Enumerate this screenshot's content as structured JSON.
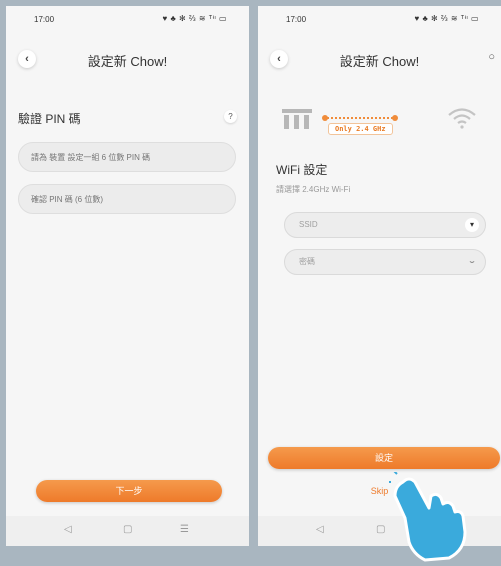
{
  "left": {
    "status": {
      "time": "17:00",
      "icons": "♥ ♣ ✻ ⅔ ≋ ᵀᶤᶥ ▭"
    },
    "header": {
      "title": "設定新 Chow!",
      "back_icon": "chevron-left"
    },
    "section_label": "驗證 PIN 碼",
    "help_label": "?",
    "pin_placeholder": "請為 裝置 設定一組 6 位數 PIN 碼",
    "confirm_placeholder": "確認 PIN 碼 (6 位數)",
    "next_label": "下一步",
    "nav": {
      "back": "◁",
      "home": "▢",
      "menu": "☰"
    }
  },
  "right": {
    "status": {
      "time": "17:00",
      "icons": "♥ ♣ ✻ ⅔ ≋ ᵀᶤᶥ ▭"
    },
    "header": {
      "title": "設定新 Chow!",
      "refresh": "○"
    },
    "only_badge": "Only 2.4 GHz",
    "wifi_title": "WiFi 設定",
    "wifi_sub": "請選擇 2.4GHz Wi-Fi",
    "ssid_label": "SSID",
    "ssid_icon": "chevron-down",
    "password_label": "密碼",
    "password_icon": "eye-closed",
    "set_label": "設定",
    "skip_label": "Skip",
    "nav": {
      "back": "◁",
      "home": "▢"
    }
  },
  "colors": {
    "accent": "#ee7a2a",
    "background": "#a9b6c0",
    "hand": "#3aaadc"
  }
}
